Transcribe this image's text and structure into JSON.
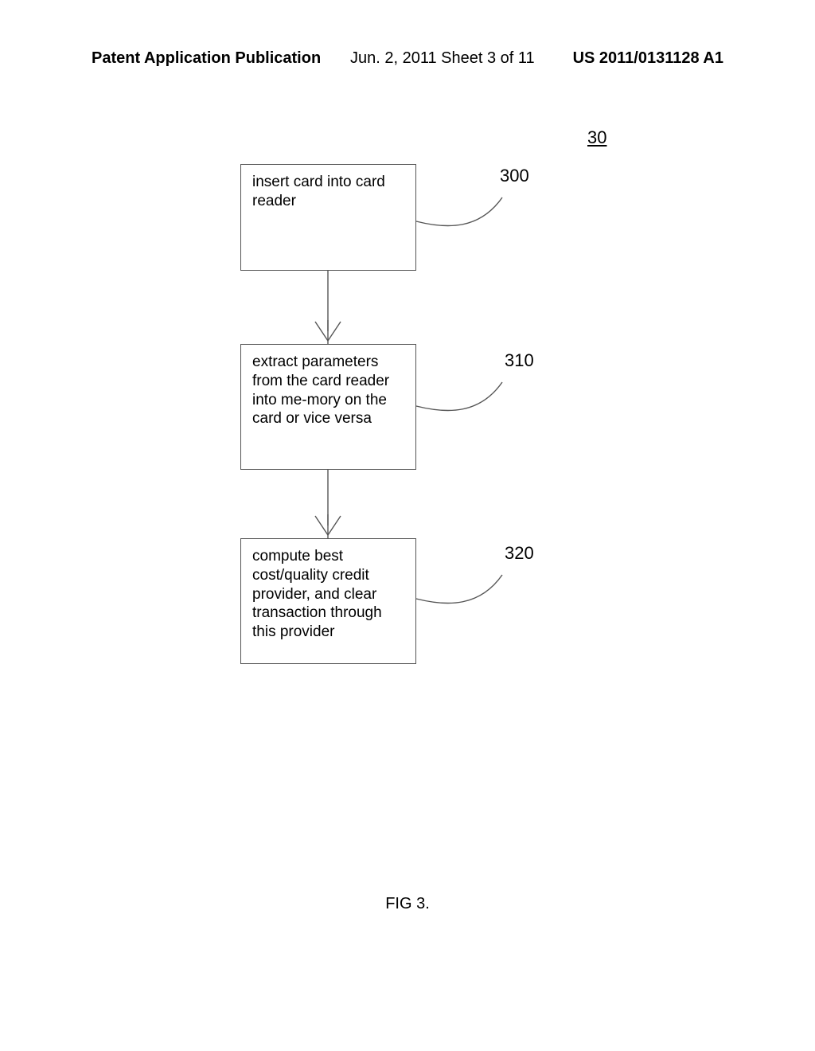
{
  "header": {
    "left": "Patent Application Publication",
    "center": "Jun. 2, 2011  Sheet 3 of 11",
    "right": "US 2011/0131128 A1"
  },
  "figure_ref": "30",
  "boxes": {
    "b300": {
      "ref": "300",
      "text": "insert card into card reader"
    },
    "b310": {
      "ref": "310",
      "text": "extract parameters from the card reader into me-mory on the card or vice versa"
    },
    "b320": {
      "ref": "320",
      "text": "compute best cost/quality credit provider, and clear transaction through this provider"
    }
  },
  "caption": "FIG 3."
}
